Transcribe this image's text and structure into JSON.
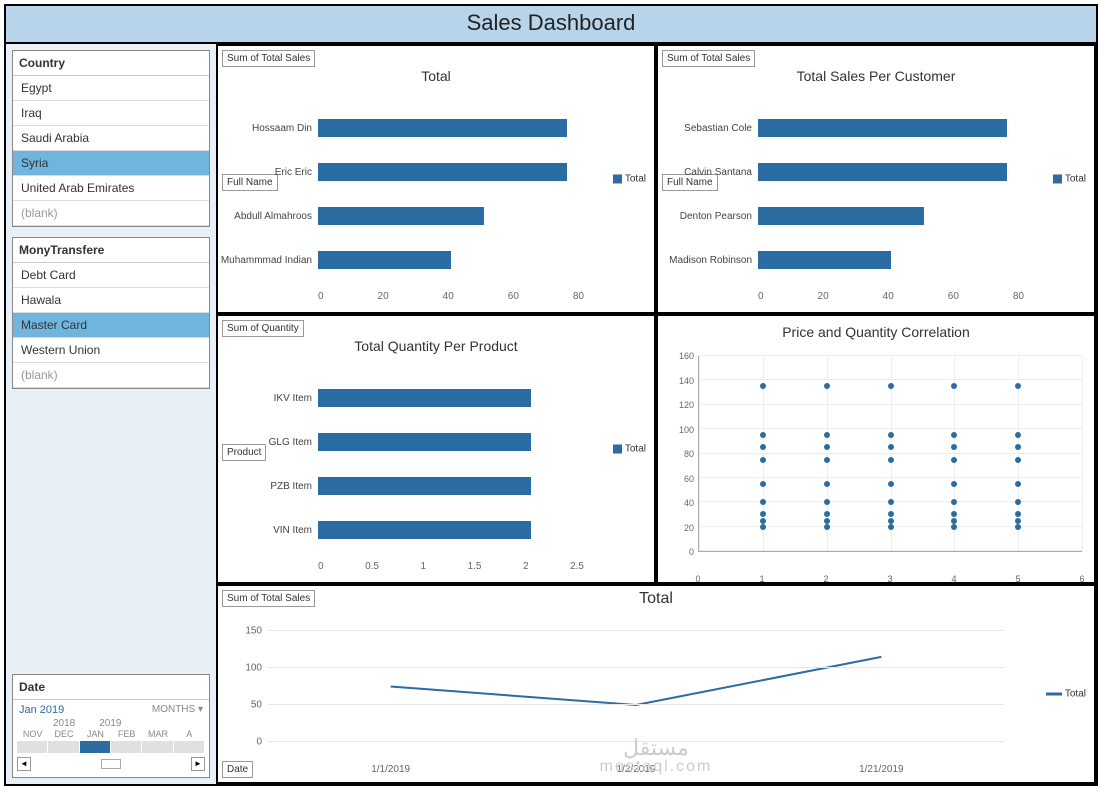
{
  "title": "Sales Dashboard",
  "slicers": {
    "country": {
      "header": "Country",
      "items": [
        "Egypt",
        "Iraq",
        "Saudi Arabia",
        "Syria",
        "United Arab Emirates",
        "(blank)"
      ],
      "selected": "Syria"
    },
    "money": {
      "header": "MonyTransfere",
      "items": [
        "Debt Card",
        "Hawala",
        "Master Card",
        "Western Union",
        "(blank)"
      ],
      "selected": "Master Card"
    },
    "date": {
      "header": "Date",
      "current": "Jan 2019",
      "unit": "MONTHS ▾",
      "years": [
        "2018",
        "2019"
      ],
      "months": [
        "NOV",
        "DEC",
        "JAN",
        "FEB",
        "MAR",
        "A"
      ],
      "selected_index": 2
    }
  },
  "labels": {
    "sum_total_sales": "Sum of Total Sales",
    "sum_quantity": "Sum of Quantity",
    "full_name": "Full Name",
    "product": "Product",
    "date": "Date",
    "total_legend": "Total"
  },
  "chart_data": [
    {
      "id": "chart_total",
      "type": "bar",
      "orientation": "horizontal",
      "title": "Total",
      "ylabel": "Full Name",
      "xlabel": "",
      "categories": [
        "Hossaam Din",
        "Eric Eric",
        "Abdull Almahroos",
        "Muhammmad Indian"
      ],
      "values": [
        75,
        75,
        50,
        40
      ],
      "xlim": [
        0,
        80
      ],
      "xticks": [
        0,
        20,
        40,
        60,
        80
      ],
      "legend": [
        "Total"
      ]
    },
    {
      "id": "chart_customer",
      "type": "bar",
      "orientation": "horizontal",
      "title": "Total Sales Per Customer",
      "ylabel": "Full Name",
      "xlabel": "",
      "categories": [
        "Sebastian Cole",
        "Calvin Santana",
        "Denton Pearson",
        "Madison Robinson"
      ],
      "values": [
        75,
        75,
        50,
        40
      ],
      "xlim": [
        0,
        80
      ],
      "xticks": [
        0,
        20,
        40,
        60,
        80
      ],
      "legend": [
        "Total"
      ]
    },
    {
      "id": "chart_quantity",
      "type": "bar",
      "orientation": "horizontal",
      "title": "Total Quantity Per Product",
      "ylabel": "Product",
      "xlabel": "",
      "categories": [
        "IKV Item",
        "GLG Item",
        "PZB Item",
        "VIN Item"
      ],
      "values": [
        2,
        2,
        2,
        2
      ],
      "xlim": [
        0,
        2.5
      ],
      "xticks": [
        0,
        0.5,
        1,
        1.5,
        2,
        2.5
      ],
      "legend": [
        "Total"
      ]
    },
    {
      "id": "chart_scatter",
      "type": "scatter",
      "title": "Price and Quantity Correlation",
      "xlabel": "",
      "ylabel": "",
      "xlim": [
        0,
        6
      ],
      "ylim": [
        0,
        160
      ],
      "xticks": [
        0,
        1,
        2,
        3,
        4,
        5,
        6
      ],
      "yticks": [
        0,
        20,
        40,
        60,
        80,
        100,
        120,
        140,
        160
      ],
      "series": [
        {
          "name": "points",
          "x": [
            1,
            1,
            1,
            1,
            1,
            1,
            1,
            1,
            1,
            2,
            2,
            2,
            2,
            2,
            2,
            2,
            2,
            2,
            3,
            3,
            3,
            3,
            3,
            3,
            3,
            3,
            3,
            4,
            4,
            4,
            4,
            4,
            4,
            4,
            4,
            4,
            5,
            5,
            5,
            5,
            5,
            5,
            5,
            5,
            5
          ],
          "y": [
            20,
            25,
            30,
            40,
            55,
            75,
            85,
            95,
            135,
            20,
            25,
            30,
            40,
            55,
            75,
            85,
            95,
            135,
            20,
            25,
            30,
            40,
            55,
            75,
            85,
            95,
            135,
            20,
            25,
            30,
            40,
            55,
            75,
            85,
            95,
            135,
            20,
            25,
            30,
            40,
            55,
            75,
            85,
            95,
            135
          ]
        }
      ]
    },
    {
      "id": "chart_line",
      "type": "line",
      "title": "Total",
      "xlabel": "Date",
      "ylabel": "",
      "ylim": [
        0,
        150
      ],
      "yticks": [
        0,
        50,
        100,
        150
      ],
      "categories": [
        "1/1/2019",
        "1/2/2019",
        "1/21/2019"
      ],
      "values": [
        75,
        50,
        115
      ],
      "legend": [
        "Total"
      ]
    }
  ],
  "watermark": {
    "ar": "مستقل",
    "en": "mostaql.com"
  }
}
